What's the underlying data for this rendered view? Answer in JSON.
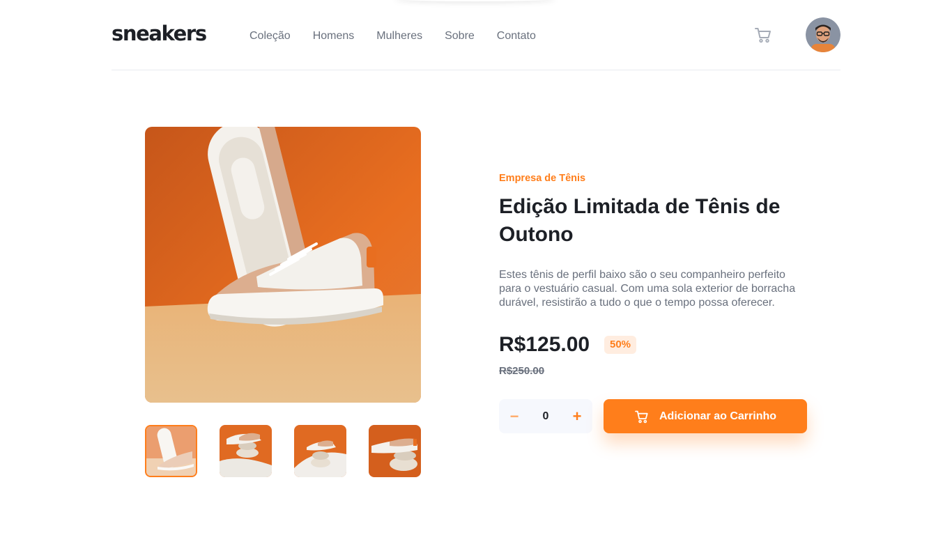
{
  "brand": {
    "logo": "sneakers",
    "accent": "#ff7e1b",
    "dark": "#1d2026",
    "muted": "#69707d"
  },
  "nav": {
    "items": [
      {
        "label": "Coleção"
      },
      {
        "label": "Homens"
      },
      {
        "label": "Mulheres"
      },
      {
        "label": "Sobre"
      },
      {
        "label": "Contato"
      }
    ]
  },
  "header": {
    "cart_icon": "cart-icon",
    "avatar_icon": "avatar"
  },
  "gallery": {
    "active_index": 0,
    "thumbnail_count": 4
  },
  "product": {
    "company": "Empresa de Tênis",
    "title": "Edição Limitada de Tênis de Outono",
    "description": "Estes tênis de perfil baixo são o seu companheiro perfeito para o vestuário casual. Com uma sola exterior de borracha durável, resistirão a tudo o que o tempo possa oferecer.",
    "price": "R$125.00",
    "discount": "50%",
    "original_price": "R$250.00"
  },
  "quantity": {
    "minus": "−",
    "value": "0",
    "plus": "+"
  },
  "cart_button": {
    "label": "Adicionar ao Carrinho",
    "icon": "cart-icon"
  }
}
